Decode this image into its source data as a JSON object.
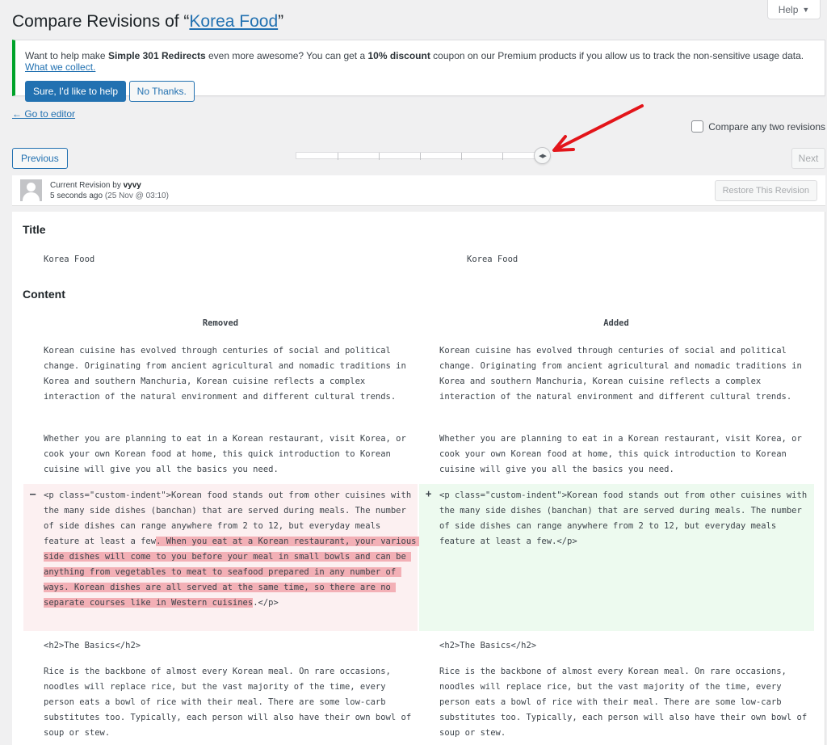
{
  "help": {
    "label": "Help",
    "icon": "triangle-down-icon"
  },
  "header": {
    "title_prefix": "Compare Revisions of “",
    "post_title": "Korea Food",
    "title_suffix": "”"
  },
  "notice": {
    "text_1": "Want to help make ",
    "plugin_name": "Simple 301 Redirects",
    "text_2": " even more awesome? You can get a ",
    "discount": "10% discount",
    "text_3": " coupon on our Premium products if you allow us to track the non-sensitive usage data. ",
    "link": "What we collect.",
    "accept_label": "Sure, I'd like to help",
    "decline_label": "No Thanks.",
    "accent_color": "#00a32a"
  },
  "nav": {
    "go_to_editor": "← Go to editor",
    "compare_two_label": "Compare any two revisions",
    "compare_two_checked": false,
    "previous_label": "Previous",
    "next_label": "Next",
    "next_disabled": true,
    "slider": {
      "revision_count": 7,
      "selected_index": 6,
      "handle_icon": "arrows-left-right-icon"
    }
  },
  "annotation": {
    "type": "red-arrow",
    "points_to": "slider-handle",
    "color": "#e3151a"
  },
  "revision_meta": {
    "label": "Current Revision by ",
    "author": "vyvy",
    "time_ago": "5 seconds ago",
    "date": "(25 Nov @ 03:10)",
    "restore_label": "Restore This Revision",
    "restore_disabled": true
  },
  "diff": {
    "title_heading": "Title",
    "title_left": "Korea Food",
    "title_right": "Korea Food",
    "content_heading": "Content",
    "removed_label": "Removed",
    "added_label": "Added",
    "para1": "Korean cuisine has evolved through centuries of social and political change. Originating from ancient agricultural and nomadic traditions in Korea and southern Manchuria, Korean cuisine reflects a complex interaction of the natural environment and different cultural trends.",
    "para2": "Whether you are planning to eat in a Korean restaurant, visit Korea, or cook your own Korean food at home, this quick introduction to Korean cuisine will give you all the basics you need.",
    "changed_left_plain": "<p class=\"custom-indent\">Korean food stands out from other cuisines with the many side dishes (banchan) that are served during meals. The number of side dishes can range anywhere from 2 to 12, but everyday meals feature at least a few",
    "changed_left_removed": ". When you eat at a Korean restaurant, your various side dishes will come to you before your meal in small bowls and can be anything from vegetables to meat to seafood prepared in any number of ways. Korean dishes are all served at the same time, so there are no separate courses like in Western cuisines",
    "changed_left_tail": ".</p>",
    "changed_right": "<p class=\"custom-indent\">Korean food stands out from other cuisines with the many side dishes (banchan) that are served during meals. The number of side dishes can range anywhere from 2 to 12, but everyday meals feature at least a few.</p>",
    "minus_sign": "–",
    "plus_sign": "+",
    "h2_line": "<h2>The Basics</h2>",
    "para3": "Rice is the backbone of almost every Korean meal. On rare occasions, noodles will replace rice, but the vast majority of the time, every person eats a bowl of rice with their meal. There are some low-carb substitutes too. Typically, each person will also have their own bowl of soup or stew.",
    "colors": {
      "removed_bg": "#fcf0f1",
      "removed_mark": "#f3b0b6",
      "added_bg": "#edfaef"
    }
  }
}
